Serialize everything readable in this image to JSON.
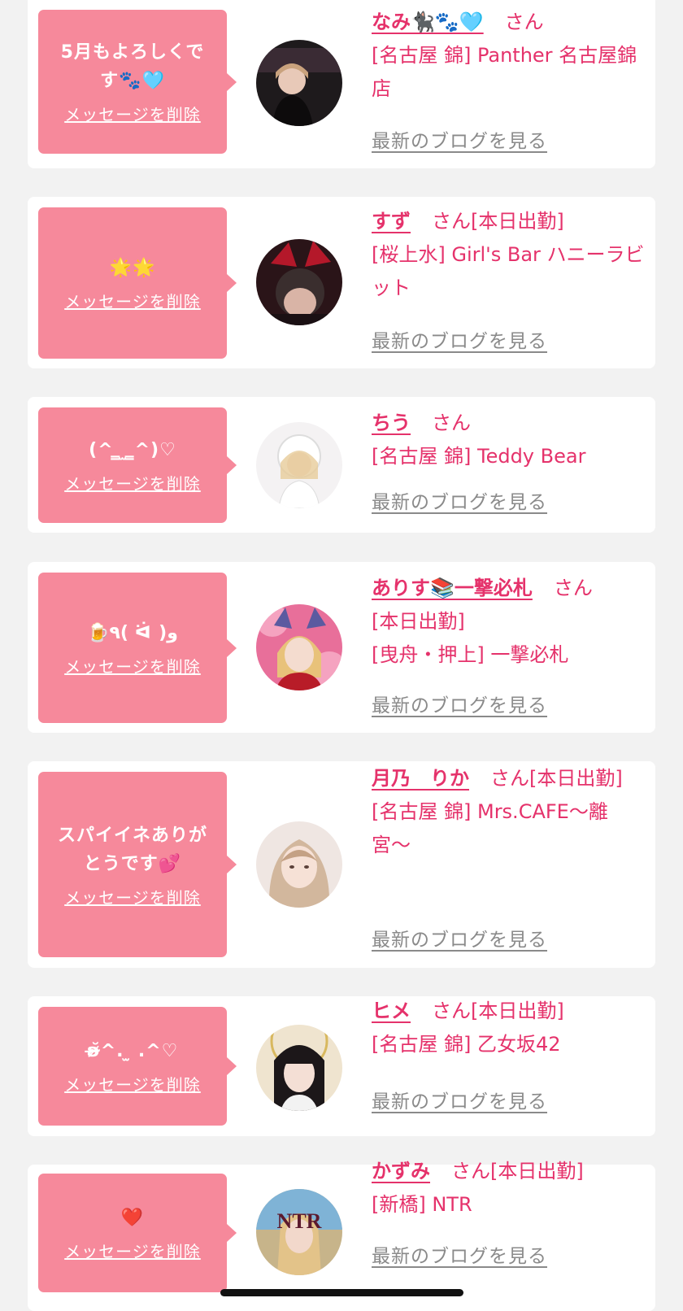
{
  "common": {
    "delete_label": "メッセージを削除",
    "blog_label": "最新のブログを見る",
    "san": "さん"
  },
  "colors": {
    "background": "#f2f2f2",
    "card": "#ffffff",
    "bubble": "#f6899b",
    "name_text": "#e5326b",
    "blog_link": "#8a8a8a"
  },
  "entries": [
    {
      "message": "5月もよろしくで\nす🐾🩵",
      "name": "なみ🐈‍⬛🐾🩵",
      "status": "",
      "shop": "[名古屋 錦] Panther 名古屋錦店",
      "avatar_icon": "avatar-photo-icon"
    },
    {
      "message": "🌟🌟",
      "name": "すず",
      "status": "[本日出勤]",
      "shop": "[桜上水] Girl's Bar ハニーラビット",
      "avatar_icon": "avatar-photo-icon"
    },
    {
      "message": "(^ ̳ ̫ ̳^)♡",
      "name": "ちう",
      "status": "",
      "shop": "[名古屋 錦] Teddy Bear",
      "avatar_icon": "avatar-photo-icon"
    },
    {
      "message": "🍺٩( ᐛ )و",
      "name": "ありす📚一撃必札",
      "status": "",
      "shop": "[本日出勤]\n[曳舟・押上] 一撃必札",
      "avatar_icon": "avatar-photo-icon"
    },
    {
      "message": "スパイイネありが\nとうです💕",
      "name": "月乃　りか",
      "status": "[本日出勤]",
      "shop": "[名古屋 錦] Mrs.CAFE〜離宮〜",
      "avatar_icon": "avatar-photo-icon"
    },
    {
      "message": "ʚ̴̶̷̆^. ̫ .^♡",
      "name": "ヒメ",
      "status": "[本日出勤]",
      "shop": "[名古屋 錦] 乙女坂42",
      "avatar_icon": "avatar-photo-icon"
    },
    {
      "message": "❤️",
      "name": "かずみ",
      "status": "[本日出勤]",
      "shop": "[新橋] NTR",
      "avatar_icon": "avatar-photo-icon"
    }
  ]
}
